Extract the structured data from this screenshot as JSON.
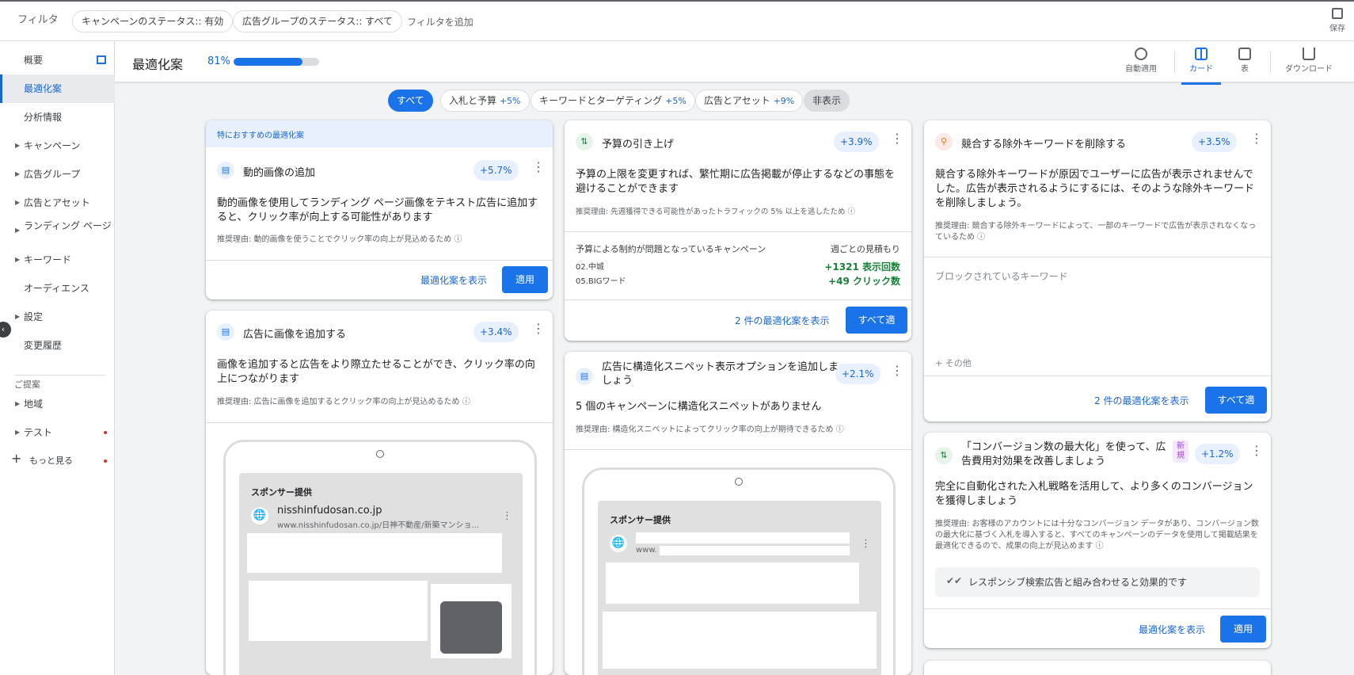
{
  "topbar": {
    "filter_label": "フィルタ",
    "chips": [
      "キャンペーンのステータス:: 有効",
      "広告グループのステータス:: すべて"
    ],
    "add_filter": "フィルタを追加",
    "save": "保存"
  },
  "sidebar": {
    "items": [
      {
        "label": "概要"
      },
      {
        "label": "最適化案"
      },
      {
        "label": "分析情報"
      },
      {
        "label": "キャンペーン"
      },
      {
        "label": "広告グループ"
      },
      {
        "label": "広告とアセット"
      },
      {
        "label": "ランディング ページ"
      },
      {
        "label": "キーワード"
      },
      {
        "label": "オーディエンス"
      },
      {
        "label": "設定"
      },
      {
        "label": "変更履歴"
      }
    ],
    "section": "ご提案",
    "extra": [
      {
        "label": "地域"
      },
      {
        "label": "テスト"
      },
      {
        "label": "もっと見る"
      }
    ]
  },
  "header": {
    "title": "最適化案",
    "score": "81%",
    "score_value": 0.81,
    "views": [
      "自動適用",
      "カード",
      "表",
      "ダウンロード"
    ]
  },
  "tabs": [
    {
      "label": "すべて",
      "boost": ""
    },
    {
      "label": "入札と予算",
      "boost": "+5%"
    },
    {
      "label": "キーワードとターゲティング",
      "boost": "+5%"
    },
    {
      "label": "広告とアセット",
      "boost": "+9%"
    },
    {
      "label": "非表示",
      "boost": ""
    }
  ],
  "cards": {
    "c1": {
      "top": "特におすすめの最適化案",
      "title": "動的画像の追加",
      "badge": "+5.7%",
      "body": "動的画像を使用してランディング ページ画像をテキスト広告に追加すると、クリック率が向上する可能性があります",
      "reason": "推奨理由: 動的画像を使うことでクリック率の向上が見込めるため ⓘ",
      "link": "最適化案を表示",
      "apply": "適用"
    },
    "c2": {
      "title": "広告に画像を追加する",
      "badge": "+3.4%",
      "body": "画像を追加すると広告をより際立たせることができ、クリック率の向上につながります",
      "reason": "推奨理由: 広告に画像を追加するとクリック率の向上が見込めるため ⓘ",
      "sponsor": "スポンサー提供",
      "domain": "nisshinfudosan.co.jp",
      "url": "www.nisshinfudosan.co.jp/日神不動産/新築マンショ..."
    },
    "c3": {
      "title": "予算の引き上げ",
      "badge": "+3.9%",
      "body": "予算の上限を変更すれば、繁忙期に広告掲載が停止するなどの事態を避けることができます",
      "reason": "推奨理由: 先週獲得できる可能性があったトラフィックの 5% 以上を逃したため ⓘ",
      "col1": "予算による制約が問題となっているキャンペーン",
      "col2": "週ごとの見積もり",
      "campaigns": [
        "02.中城",
        "05.BIGワード"
      ],
      "est1": "+1321 表示回数",
      "est2": "+49 クリック数",
      "link": "2 件の最適化案を表示",
      "apply": "すべて適用"
    },
    "c4": {
      "title": "広告に構造化スニペット表示オプションを追加しましょう",
      "badge": "+2.1%",
      "body": "5 個のキャンペーンに構造化スニペットがありません",
      "reason": "推奨理由: 構造化スニペットによってクリック率の向上が期待できるため ⓘ",
      "sponsor": "スポンサー提供",
      "url": "www."
    },
    "c5": {
      "title": "競合する除外キーワードを削除する",
      "badge": "+3.5%",
      "body": "競合する除外キーワードが原因でユーザーに広告が表示されませんでした。広告が表示されるようにするには、そのような除外キーワードを削除しましょう。",
      "reason": "推奨理由: 競合する除外キーワードによって、一部のキーワードで広告が表示されなくなっているため ⓘ",
      "blocked": "ブロックされているキーワード",
      "more": "+ その他",
      "link": "2 件の最適化案を表示",
      "apply": "すべて適用"
    },
    "c6": {
      "title": "「コンバージョン数の最大化」を使って、広告費用対効果を改善しましょう",
      "new": "新規",
      "badge": "+1.2%",
      "body": "完全に自動化された入札戦略を活用して、より多くのコンバージョンを獲得しましょう",
      "reason": "推奨理由: お客様のアカウントには十分なコンバージョン データがあり、コンバージョン数の最大化に基づく入札を導入すると、すべてのキャンペーンのデータを使用して掲載結果を最適化できるので、成果の向上が見込めます ⓘ",
      "tip": "レスポンシブ検索広告と組み合わせると効果的です",
      "link": "最適化案を表示",
      "apply": "適用"
    }
  },
  "colors": {
    "accent": "#1a73e8",
    "positive": "#188038"
  }
}
